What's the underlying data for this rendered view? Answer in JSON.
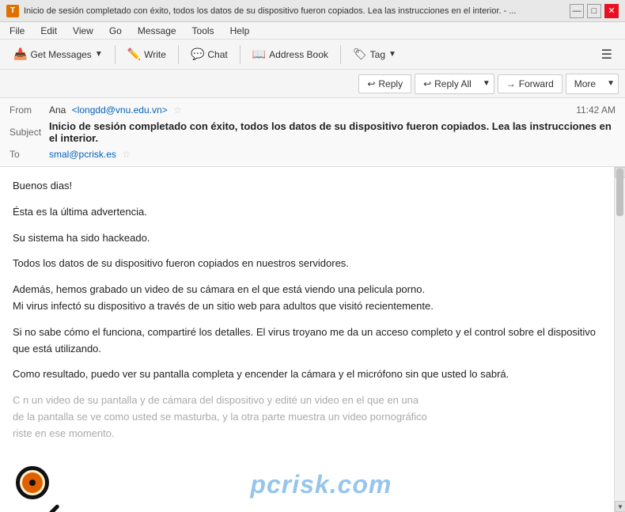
{
  "titlebar": {
    "icon": "T",
    "text": "Inicio de sesión completado con éxito, todos los datos de su dispositivo fueron copiados. Lea las instrucciones en el interior. - ...",
    "minimize": "—",
    "maximize": "□",
    "close": "✕"
  },
  "menubar": {
    "items": [
      "File",
      "Edit",
      "View",
      "Go",
      "Message",
      "Tools",
      "Help"
    ]
  },
  "toolbar": {
    "get_messages": "Get Messages",
    "write": "Write",
    "chat": "Chat",
    "address_book": "Address Book",
    "tag": "Tag"
  },
  "actions": {
    "reply": "Reply",
    "reply_all": "Reply All",
    "forward": "Forward",
    "more": "More"
  },
  "email": {
    "from_label": "From",
    "from_name": "Ana",
    "from_email": "<longdd@vnu.edu.vn>",
    "subject_label": "Subject",
    "subject": "Inicio de sesión completado con éxito, todos los datos de su dispositivo fueron copiados. Lea las instrucciones en el interior.",
    "time": "11:42 AM",
    "to_label": "To",
    "to_email": "smal@pcrisk.es"
  },
  "body": {
    "p1": "Buenos  dias!",
    "p2": "Ésta es  la última  advertencia.",
    "p3": "Su sistema  ha sido  hackeado.",
    "p4": "Todos  los  datos de  su dispositivo  fueron copiados  en nuestros  servidores.",
    "p5": "Además, hemos grabado  un video  de su  cámara en  el que  está viendo  una pelicula  porno.\nMi virus  infectó su  dispositivo a  través de  un sitio web  para adultos  que visitó  recientemente.",
    "p6": "Si no  sabe cómo  el funciona, compartiré  los detalles. El virus  troyano me  da un  acceso completo  y el control  sobre el  dispositivo que  está utilizando.",
    "p7": "Como  resultado, puedo  ver su  pantalla completa  y encender  la cámara  y el  micrófono sin que  usted lo  sabrá.",
    "p8_partial": "C      n un  video de su pantalla   y de  cámara del  dispositivo y  edité un  video en  el que  en una\n   de la pantalla se  ve como  usted se  masturba, y  la otra  parte muestra  un video  pornográfico\n   riste en ese  momento."
  },
  "watermark": {
    "text": "pcrisk.com"
  }
}
